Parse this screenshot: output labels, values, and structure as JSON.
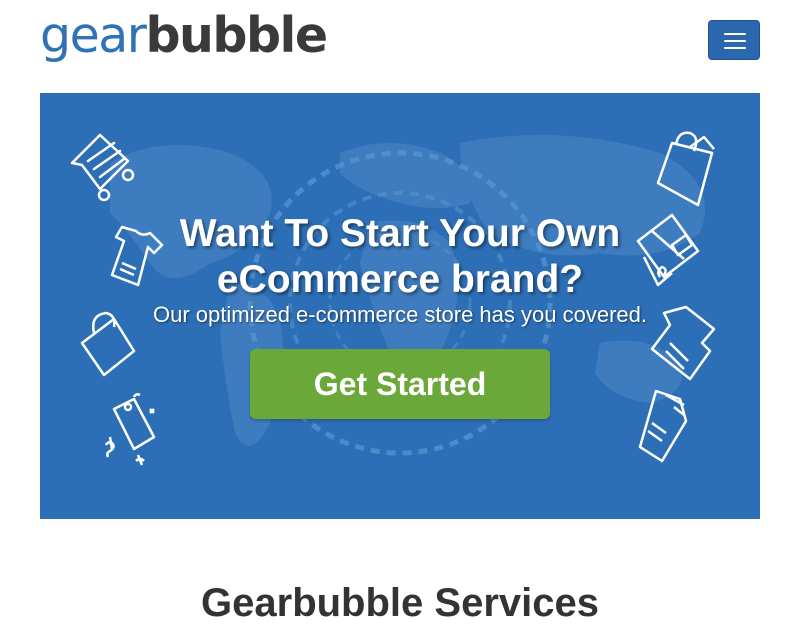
{
  "header": {
    "logo_part1": "gear",
    "logo_part2": "bubble",
    "menu_icon": "hamburger-menu-icon"
  },
  "banner": {
    "headline_line1": "Want To Start Your Own",
    "headline_line2": "eCommerce brand?",
    "subline": "Our optimized e-commerce store has you covered.",
    "cta_label": "Get Started",
    "icons": [
      "shopping-cart-icon",
      "t-shirt-icon",
      "shopping-bag-icon",
      "price-tags-icon",
      "shopping-bag-icon",
      "credit-card-icon",
      "t-shirt-icon",
      "wallet-icon"
    ]
  },
  "colors": {
    "brand_blue": "#2f72b8",
    "logo_dark": "#3a3a3a",
    "banner_blue": "#2d6fb6",
    "cta_green": "#6aa83a"
  },
  "section": {
    "title_partial": "Gearbubble Services"
  }
}
